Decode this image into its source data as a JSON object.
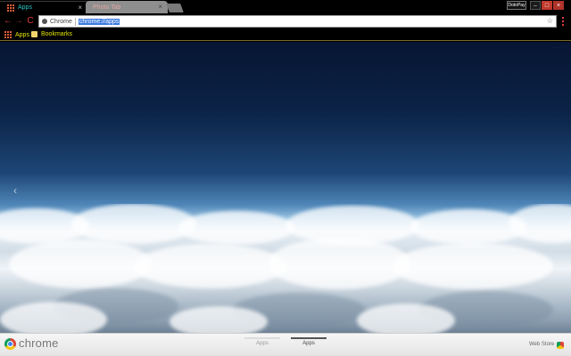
{
  "tabs": [
    {
      "label": "Apps",
      "active": true
    },
    {
      "label": "Photo Tab",
      "active": false
    }
  ],
  "window": {
    "profile_label": "DotoPay",
    "minimize_glyph": "–",
    "maximize_glyph": "□",
    "close_glyph": "×"
  },
  "toolbar": {
    "back_glyph": "←",
    "forward_glyph": "→",
    "reload_glyph": "C",
    "chip_label": "Chrome",
    "url": "chrome://apps",
    "star_glyph": "☆"
  },
  "bookmarks": {
    "apps_label": "Apps",
    "folder_label": "Bookmarks"
  },
  "content": {
    "corner_link": "········",
    "prev_arrow": "‹"
  },
  "bottombar": {
    "brand": "chrome",
    "page_tabs": [
      "Apps",
      "Apps"
    ],
    "active_page": 1,
    "webstore_label": "Web Store"
  },
  "colors": {
    "accent_red": "#e03a3a",
    "active_tab_text": "#22c7c7",
    "bookmark_text": "#e6e600",
    "url_highlight": "#3e7be0"
  }
}
